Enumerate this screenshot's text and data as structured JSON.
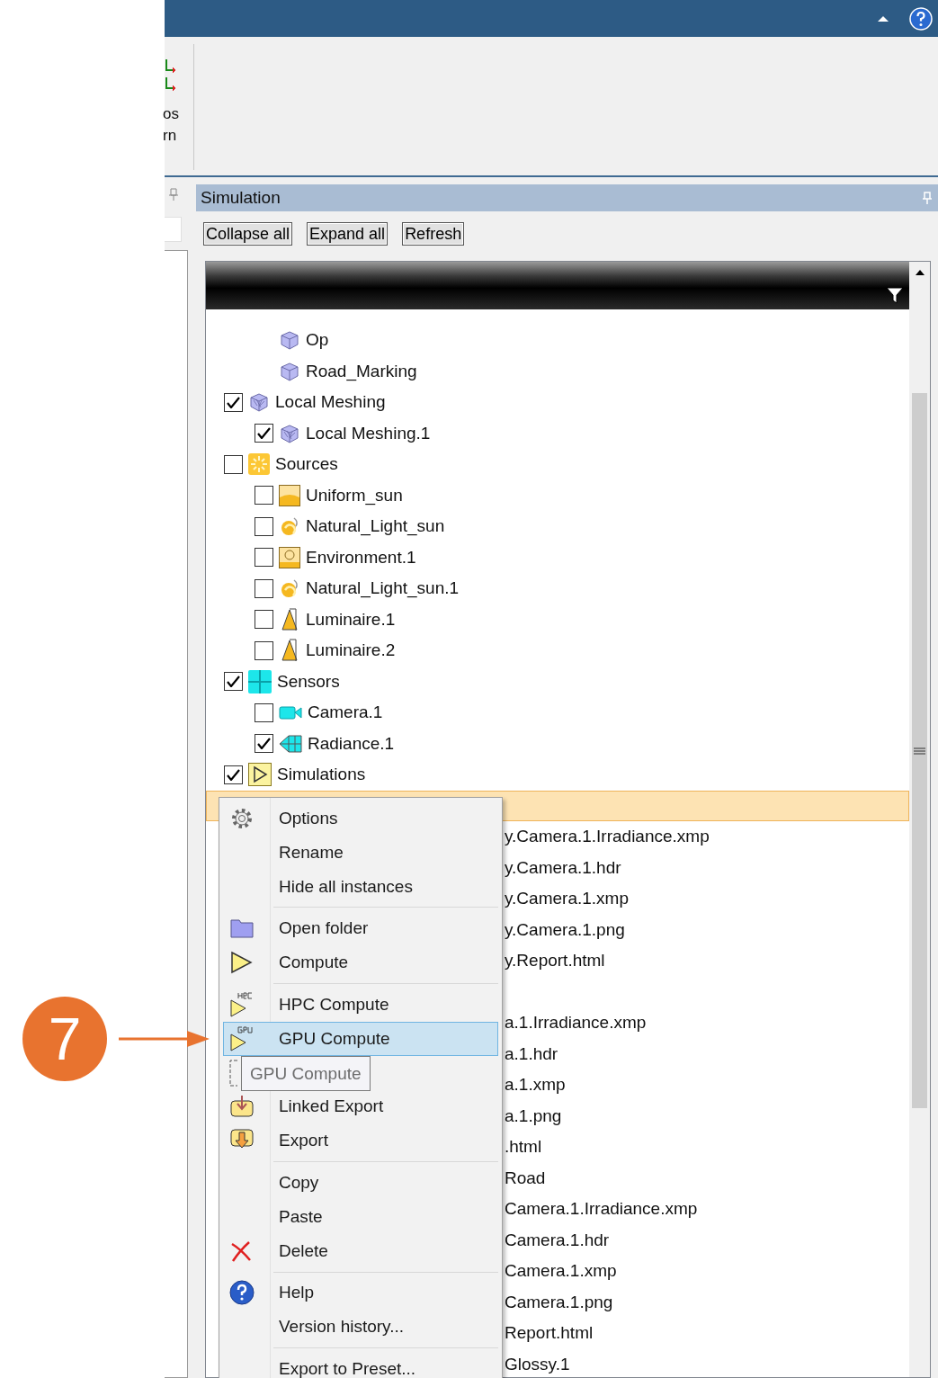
{
  "callout": {
    "number": "7"
  },
  "ribbon": {
    "cut_labels": [
      "os",
      "rn"
    ]
  },
  "panel": {
    "title": "Simulation",
    "buttons": [
      "Collapse all",
      "Expand all",
      "Refresh"
    ]
  },
  "tree": {
    "nodes": [
      {
        "kind": "group",
        "children": [
          {
            "label": "Op",
            "kind": "geometry",
            "selected": false
          },
          {
            "label": "Road_Marking",
            "kind": "geometry",
            "selected": false
          }
        ]
      },
      {
        "label": "Local Meshing",
        "kind": "meshing",
        "checked": true,
        "selected": false,
        "children": [
          {
            "label": "Local Meshing.1",
            "kind": "meshing",
            "checked": true,
            "selected": false
          }
        ]
      },
      {
        "label": "Sources",
        "kind": "sources",
        "checked": false,
        "selected": false,
        "children": [
          {
            "label": "Uniform_sun",
            "kind": "uniform",
            "checked": false,
            "selected": false
          },
          {
            "label": "Natural_Light_sun",
            "kind": "natural",
            "checked": false,
            "selected": false
          },
          {
            "label": "Environment.1",
            "kind": "environment",
            "checked": false,
            "selected": false
          },
          {
            "label": "Natural_Light_sun.1",
            "kind": "natural",
            "checked": false,
            "selected": false
          },
          {
            "label": "Luminaire.1",
            "kind": "luminaire",
            "checked": false,
            "selected": false
          },
          {
            "label": "Luminaire.2",
            "kind": "luminaire",
            "checked": false,
            "selected": false
          }
        ]
      },
      {
        "label": "Sensors",
        "kind": "sensors",
        "checked": true,
        "selected": false,
        "children": [
          {
            "label": "Camera.1",
            "kind": "camera",
            "checked": false,
            "selected": false
          },
          {
            "label": "Radiance.1",
            "kind": "radiance",
            "checked": true,
            "selected": false
          }
        ]
      },
      {
        "label": "Simulations",
        "kind": "simulations",
        "checked": true,
        "selected": false,
        "children": [
          {
            "kind": "simulation",
            "selected": true,
            "children": [
              {
                "label": "y.Camera.1.Irradiance.xmp",
                "kind": "file",
                "selected": false
              },
              {
                "label": "y.Camera.1.hdr",
                "kind": "file",
                "selected": false
              },
              {
                "label": "y.Camera.1.xmp",
                "kind": "file",
                "selected": false
              },
              {
                "label": "y.Camera.1.png",
                "kind": "file",
                "selected": false
              },
              {
                "label": "y.Report.html",
                "kind": "file",
                "selected": false
              },
              {
                "kind": "blank"
              },
              {
                "label": "a.1.Irradiance.xmp",
                "kind": "file",
                "selected": false
              },
              {
                "label": "a.1.hdr",
                "kind": "file",
                "selected": false
              },
              {
                "label": "a.1.xmp",
                "kind": "file",
                "selected": false
              },
              {
                "label": "a.1.png",
                "kind": "file",
                "selected": false
              },
              {
                "label": ".html",
                "kind": "file",
                "selected": false
              },
              {
                "label": "Road",
                "kind": "file",
                "selected": false
              },
              {
                "label": "Camera.1.Irradiance.xmp",
                "kind": "file",
                "selected": false
              },
              {
                "label": "Camera.1.hdr",
                "kind": "file",
                "selected": false
              },
              {
                "label": "Camera.1.xmp",
                "kind": "file",
                "selected": false
              },
              {
                "label": "Camera.1.png",
                "kind": "file",
                "selected": false
              },
              {
                "label": "Report.html",
                "kind": "file",
                "selected": false
              },
              {
                "label": "Glossy.1",
                "kind": "file",
                "selected": false
              }
            ]
          }
        ]
      }
    ]
  },
  "menu": {
    "groups": [
      [
        {
          "label": "Options",
          "kind": "gear",
          "selected": false
        },
        {
          "label": "Rename",
          "kind": "none",
          "selected": false
        },
        {
          "label": "Hide all instances",
          "kind": "none",
          "selected": false
        }
      ],
      [
        {
          "label": "Open folder",
          "kind": "folder",
          "selected": false
        },
        {
          "label": "Compute",
          "kind": "play",
          "selected": false
        }
      ],
      [
        {
          "label": "HPC Compute",
          "kind": "hpc",
          "selected": false
        },
        {
          "label": "GPU Compute",
          "kind": "gpu",
          "selected": true
        },
        {
          "kind": "covered",
          "selected": false
        },
        {
          "label": "Linked Export",
          "kind": "linked-export",
          "selected": false
        },
        {
          "label": "Export",
          "kind": "export",
          "selected": false
        }
      ],
      [
        {
          "label": "Copy",
          "kind": "none",
          "selected": false
        },
        {
          "label": "Paste",
          "kind": "none",
          "selected": false
        },
        {
          "label": "Delete",
          "kind": "delete",
          "selected": false
        }
      ],
      [
        {
          "label": "Help",
          "kind": "help",
          "selected": false
        },
        {
          "label": "Version history...",
          "kind": "none",
          "selected": false
        }
      ],
      [
        {
          "label": "Export to Preset...",
          "kind": "none",
          "selected": false
        }
      ]
    ]
  },
  "tooltip": {
    "text": "GPU Compute"
  }
}
